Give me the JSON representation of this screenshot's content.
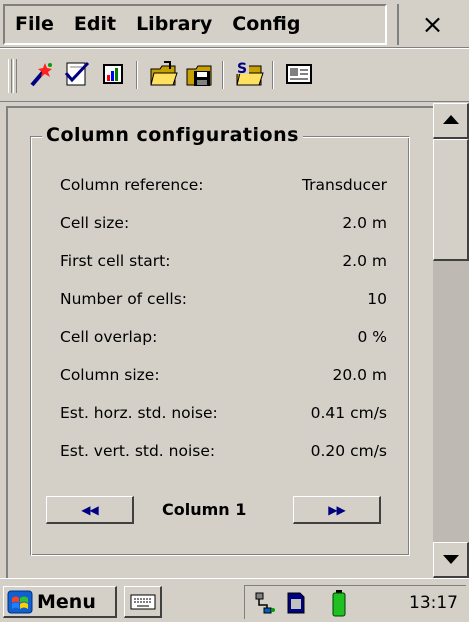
{
  "menu": {
    "items": [
      "File",
      "Edit",
      "Library",
      "Config"
    ],
    "close_label": "×"
  },
  "toolbar": {
    "buttons": [
      "wand-icon",
      "checklist-icon",
      "chart-icon",
      "open-folder-icon",
      "save-disk-icon",
      "open-s-icon",
      "display-icon"
    ]
  },
  "group": {
    "title": "Column configurations",
    "rows": [
      {
        "label": "Column reference:",
        "value": "Transducer"
      },
      {
        "label": "Cell size:",
        "value": "2.0 m"
      },
      {
        "label": "First cell start:",
        "value": "2.0 m"
      },
      {
        "label": "Number of cells:",
        "value": "10"
      },
      {
        "label": "Cell overlap:",
        "value": "0 %"
      },
      {
        "label": "Column size:",
        "value": "20.0 m"
      },
      {
        "label": "Est. horz. std. noise:",
        "value": "0.41 cm/s"
      },
      {
        "label": "Est. vert. std. noise:",
        "value": "0.20 cm/s"
      }
    ]
  },
  "nav": {
    "prev_label": "◀◀",
    "column_label": "Column 1",
    "next_label": "▶▶"
  },
  "scrollbar": {
    "up": "▲",
    "down": "▼"
  },
  "taskbar": {
    "start_label": "Menu",
    "clock": "13:17"
  },
  "colors": {
    "face": "#d4d0c8",
    "shadow": "#808080",
    "accent": "#000080"
  }
}
